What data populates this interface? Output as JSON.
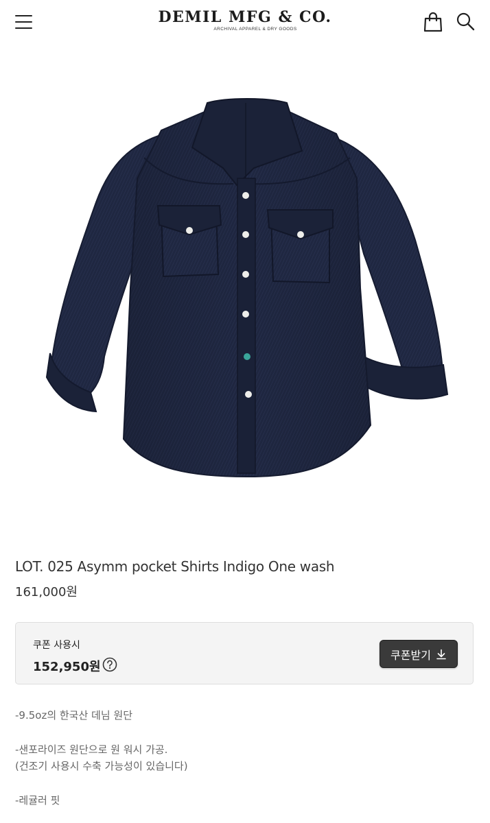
{
  "header": {
    "brand": "DEMIL MFG & CO.",
    "tagline": "ARCHIVAL APPAREL & DRY GOODS",
    "icons": [
      "menu-icon",
      "shopping-bag-icon",
      "search-icon"
    ]
  },
  "product": {
    "title": "LOT. 025 Asymm pocket Shirts Indigo One wash",
    "price": "161,000원",
    "image_subject": "indigo denim western shirt"
  },
  "coupon": {
    "label": "쿠폰 사용시",
    "price": "152,950원",
    "button_label": "쿠폰받기"
  },
  "description": {
    "line1": "-9.5oz의 한국산 데님 원단",
    "line2": "-샌포라이즈 원단으로 원 워시 가공.",
    "line3": "(건조기 사용시 수축 가능성이 있습니다)",
    "line4": "-레귤러 핏"
  },
  "colors": {
    "denim": "#1f2740",
    "button_dark": "#3a3a3a",
    "coupon_bg": "#f4f4f4",
    "text": "#333333"
  }
}
